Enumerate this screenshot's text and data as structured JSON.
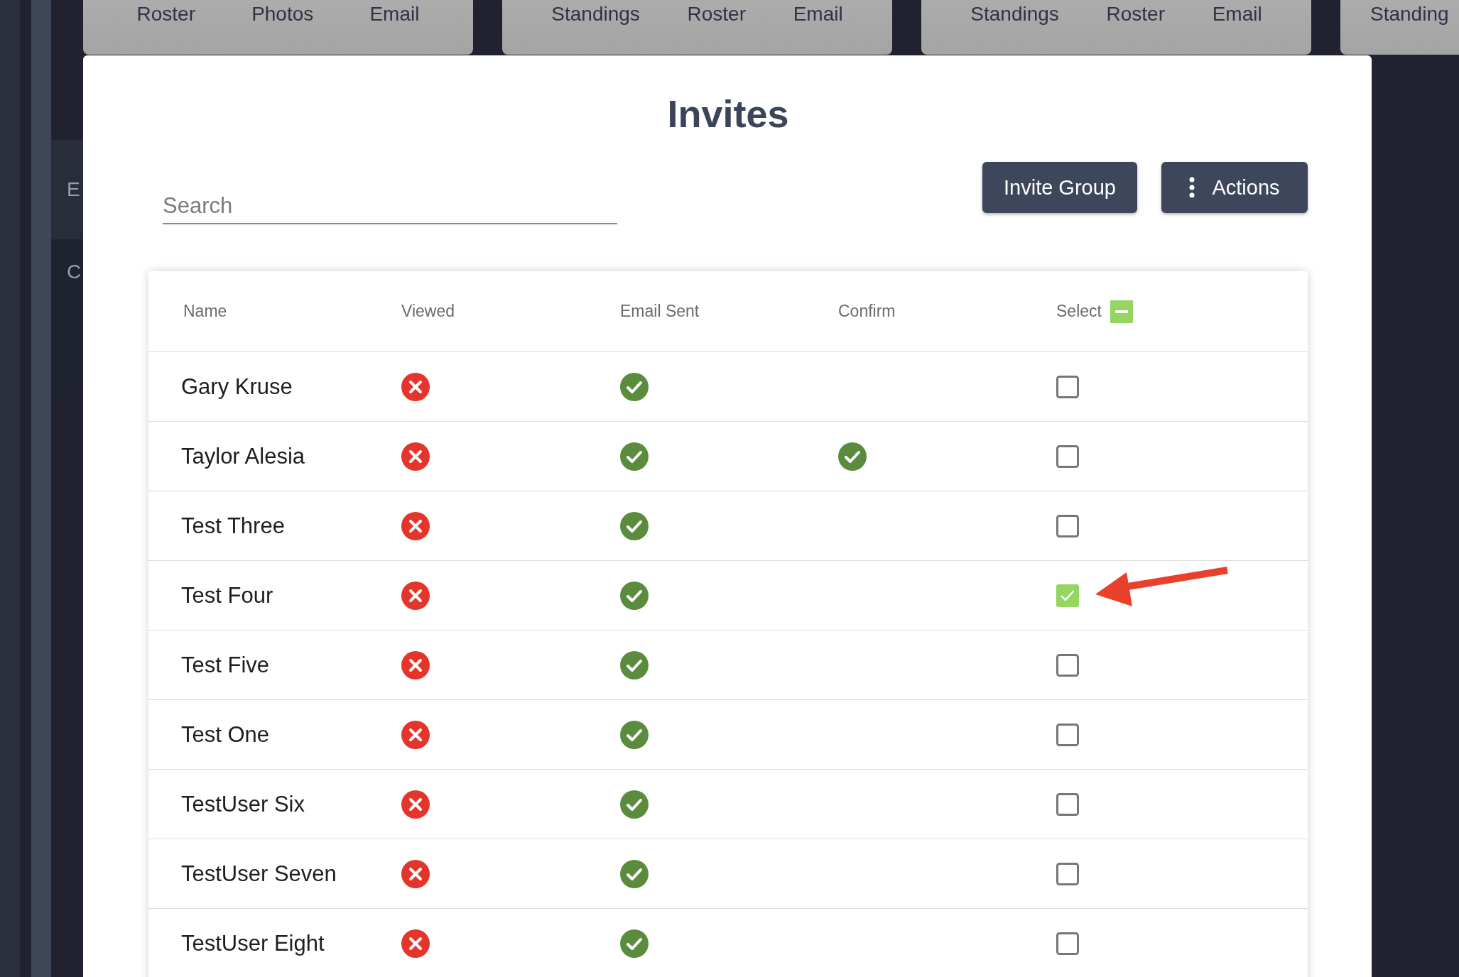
{
  "background_tabs": [
    {
      "labels": [
        "Roster",
        "Photos",
        "Email"
      ]
    },
    {
      "labels": [
        "Standings",
        "Roster",
        "Email"
      ]
    },
    {
      "labels": [
        "Standings",
        "Roster",
        "Email"
      ]
    },
    {
      "labels": [
        "Standing"
      ]
    }
  ],
  "background_letters": [
    "E",
    "C"
  ],
  "modal": {
    "title": "Invites",
    "search": {
      "placeholder": "Search"
    },
    "buttons": [
      {
        "label": "Invite Group",
        "kind": "plain"
      },
      {
        "label": "Actions",
        "kind": "menu"
      }
    ]
  },
  "table": {
    "columns": [
      "Name",
      "Viewed",
      "Email Sent",
      "Confirm",
      "Select"
    ],
    "select_all": {
      "indeterminate": true
    },
    "rows": [
      {
        "name": "Gary Kruse",
        "viewed": false,
        "email_sent": true,
        "confirm": false,
        "selected": false
      },
      {
        "name": "Taylor Alesia",
        "viewed": false,
        "email_sent": true,
        "confirm": true,
        "selected": false
      },
      {
        "name": "Test Three",
        "viewed": false,
        "email_sent": true,
        "confirm": false,
        "selected": false
      },
      {
        "name": "Test Four",
        "viewed": false,
        "email_sent": true,
        "confirm": false,
        "selected": true
      },
      {
        "name": "Test Five",
        "viewed": false,
        "email_sent": true,
        "confirm": false,
        "selected": false
      },
      {
        "name": "Test One",
        "viewed": false,
        "email_sent": true,
        "confirm": false,
        "selected": false
      },
      {
        "name": "TestUser Six",
        "viewed": false,
        "email_sent": true,
        "confirm": false,
        "selected": false
      },
      {
        "name": "TestUser Seven",
        "viewed": false,
        "email_sent": true,
        "confirm": false,
        "selected": false
      },
      {
        "name": "TestUser Eight",
        "viewed": false,
        "email_sent": true,
        "confirm": false,
        "selected": false
      }
    ]
  }
}
